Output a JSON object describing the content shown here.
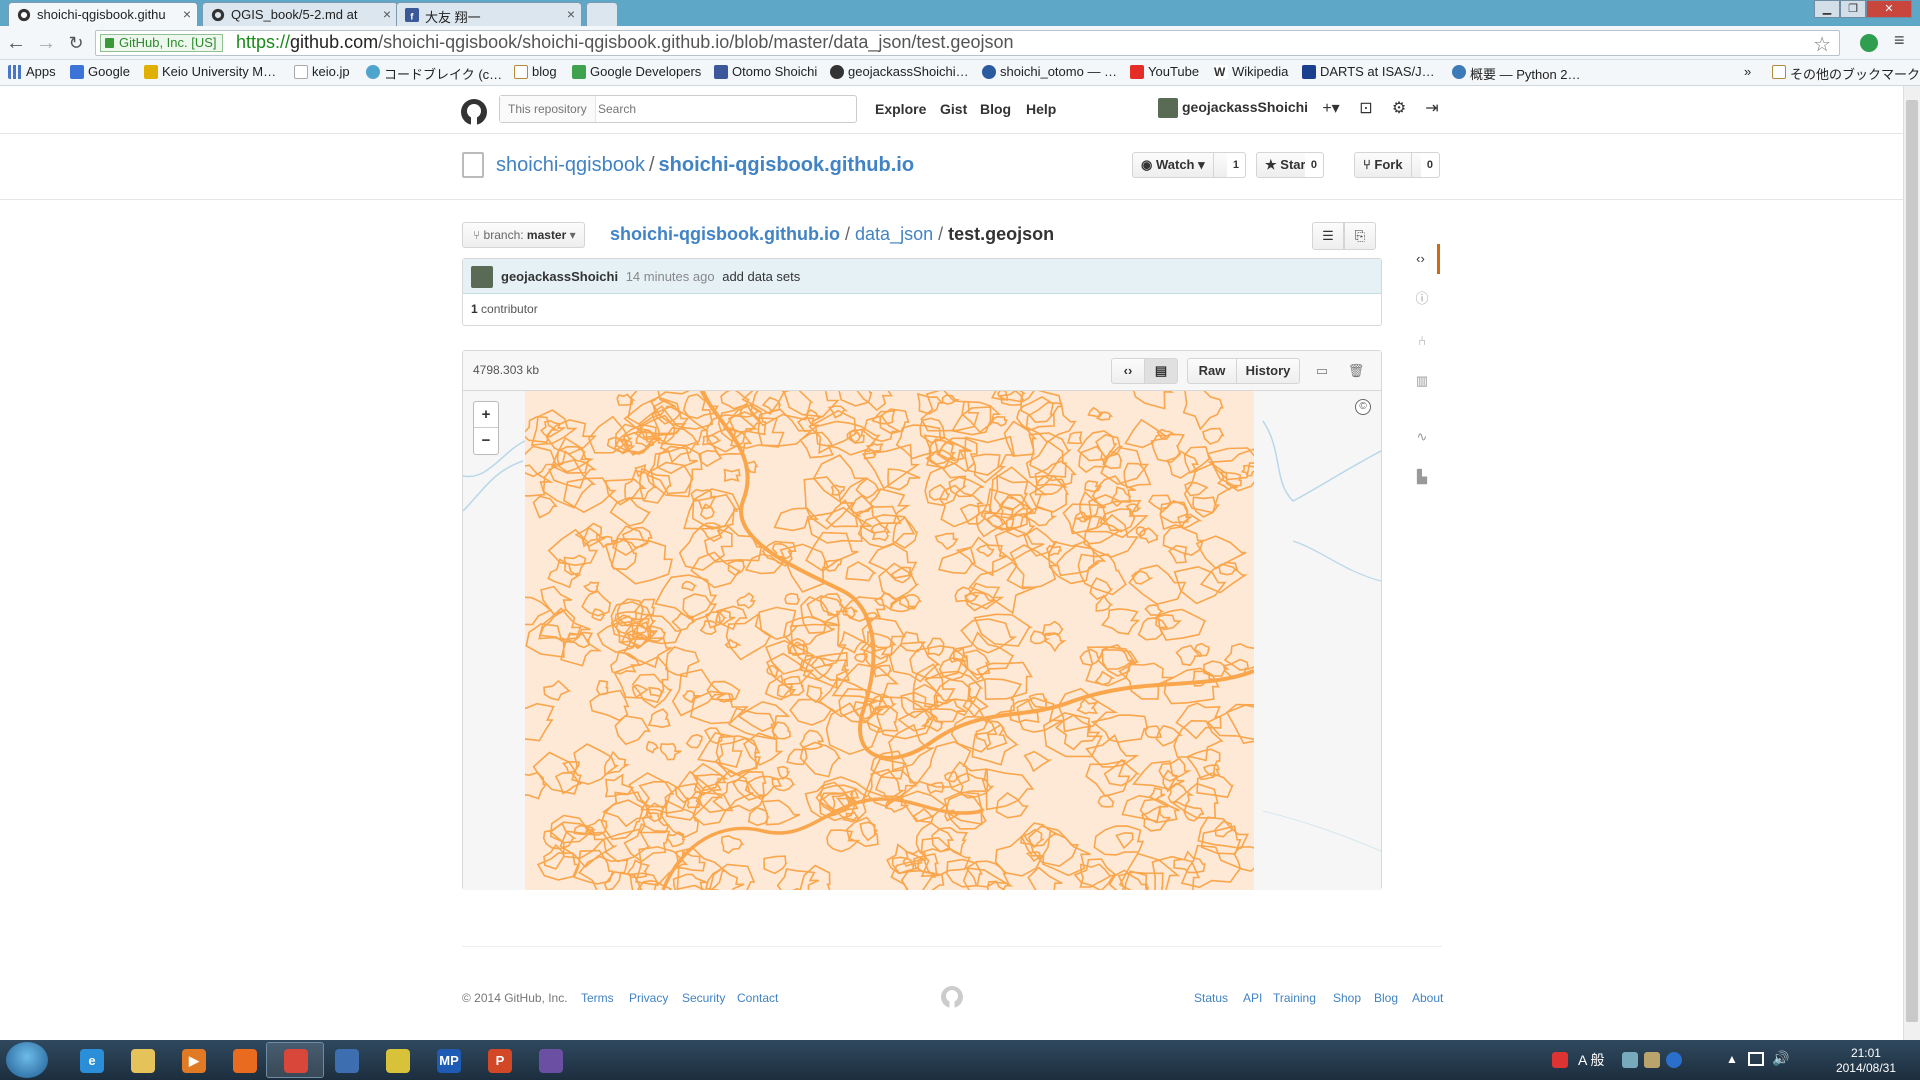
{
  "browser": {
    "tabs": [
      {
        "label": "shoichi-qgisbook.githu",
        "close": "×"
      },
      {
        "label": "QGIS_book/5-2.md at",
        "close": "×"
      },
      {
        "label": "大友 翔一",
        "close": "×"
      }
    ],
    "ev_badge": "GitHub, Inc. [US]",
    "url_scheme": "https://",
    "url_domain": "github.com",
    "url_path": "/shoichi-qgisbook/shoichi-qgisbook.github.io/blob/master/data_json/test.geojson",
    "bookmarks": [
      {
        "label": "Apps",
        "color": "#4a76c8"
      },
      {
        "label": "Google",
        "color": "#3b73d9"
      },
      {
        "label": "Keio University M…",
        "color": "#e0b000"
      },
      {
        "label": "keio.jp",
        "color": "#cccccc"
      },
      {
        "label": "コードブレイク (c…",
        "color": "#4fa3cf"
      },
      {
        "label": "blog",
        "color": "#d8b55a"
      },
      {
        "label": "Google Developers",
        "color": "#3fa34d"
      },
      {
        "label": "Otomo Shoichi",
        "color": "#3b5998"
      },
      {
        "label": "geojackassShoichi…",
        "color": "#333333"
      },
      {
        "label": "shoichi_otomo — …",
        "color": "#2b5aa0"
      },
      {
        "label": "YouTube",
        "color": "#e52d27"
      },
      {
        "label": "Wikipedia",
        "color": "#666666"
      },
      {
        "label": "DARTS at ISAS/J…",
        "color": "#1b3f8f"
      },
      {
        "label": "概要 — Python 2…",
        "color": "#3d7ab8"
      }
    ],
    "bookmarks_more": "»",
    "other_bookmarks": "その他のブックマーク"
  },
  "header": {
    "search_scope": "This repository",
    "search_placeholder": "Search",
    "nav": [
      "Explore",
      "Gist",
      "Blog",
      "Help"
    ],
    "username": "geojackassShoichi",
    "plus": "+▾"
  },
  "repo": {
    "owner": "shoichi-qgisbook",
    "separator": "/",
    "name": "shoichi-qgisbook.github.io",
    "watch": {
      "label": "Watch ▾",
      "count": "1"
    },
    "star": {
      "label": "Star",
      "count": "0"
    },
    "fork": {
      "label": "Fork",
      "count": "0"
    }
  },
  "file_nav": {
    "branch_prefix": "branch:",
    "branch": "master",
    "path_root": "shoichi-qgisbook.github.io",
    "path_dir": "data_json",
    "path_file": "test.geojson",
    "path_sep": "/"
  },
  "commit": {
    "author": "geojackassShoichi",
    "time": "14 minutes ago",
    "message": "add data sets",
    "contributors_count": "1",
    "contributors_label": "contributor"
  },
  "file": {
    "size": "4798.303 kb",
    "raw": "Raw",
    "history": "History",
    "zoom_in": "+",
    "zoom_out": "−",
    "attribution": "©"
  },
  "colors": {
    "map_fill": "#fee8d6",
    "map_stroke": "#f9a64c",
    "link": "#4183c4",
    "accent": "#d26911"
  },
  "footer": {
    "copyright": "© 2014 GitHub, Inc.",
    "left_links": [
      "Terms",
      "Privacy",
      "Security",
      "Contact"
    ],
    "right_links": [
      "Status",
      "API",
      "Training",
      "Shop",
      "Blog",
      "About"
    ]
  },
  "taskbar": {
    "time": "21:01",
    "date": "2014/08/31",
    "ime": "A 般",
    "apps": [
      {
        "name": "internet-explorer",
        "glyph": "e",
        "color": "#2a8fd8"
      },
      {
        "name": "file-explorer",
        "glyph": "",
        "color": "#e6c25a"
      },
      {
        "name": "media-player",
        "glyph": "▶",
        "color": "#e07a24"
      },
      {
        "name": "firefox",
        "glyph": "",
        "color": "#e86b1f"
      },
      {
        "name": "chrome",
        "glyph": "",
        "color": "#d9473b"
      },
      {
        "name": "python",
        "glyph": "",
        "color": "#3d6fb0"
      },
      {
        "name": "qgis",
        "glyph": "",
        "color": "#d8c23a"
      },
      {
        "name": "mp-app",
        "glyph": "MP",
        "color": "#1e5bb5"
      },
      {
        "name": "powerpoint",
        "glyph": "P",
        "color": "#d24726"
      },
      {
        "name": "github-app",
        "glyph": "",
        "color": "#6a4fa3"
      }
    ]
  }
}
